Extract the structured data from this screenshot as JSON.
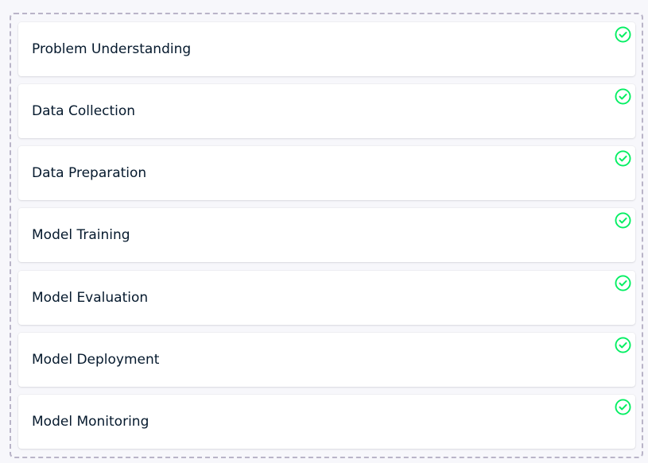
{
  "steps": [
    {
      "label": "Problem Understanding",
      "icon": "check-circle-icon",
      "status": "complete"
    },
    {
      "label": "Data Collection",
      "icon": "check-circle-icon",
      "status": "complete"
    },
    {
      "label": "Data Preparation",
      "icon": "check-circle-icon",
      "status": "complete"
    },
    {
      "label": "Model Training",
      "icon": "check-circle-icon",
      "status": "complete"
    },
    {
      "label": "Model Evaluation",
      "icon": "check-circle-icon",
      "status": "complete"
    },
    {
      "label": "Model Deployment",
      "icon": "check-circle-icon",
      "status": "complete"
    },
    {
      "label": "Model Monitoring",
      "icon": "check-circle-icon",
      "status": "complete"
    }
  ],
  "colors": {
    "check": "#03ef62",
    "text": "#05192d",
    "drop_zone_border": "#b9b4c8",
    "background": "#f7f7fb",
    "card": "#ffffff"
  }
}
